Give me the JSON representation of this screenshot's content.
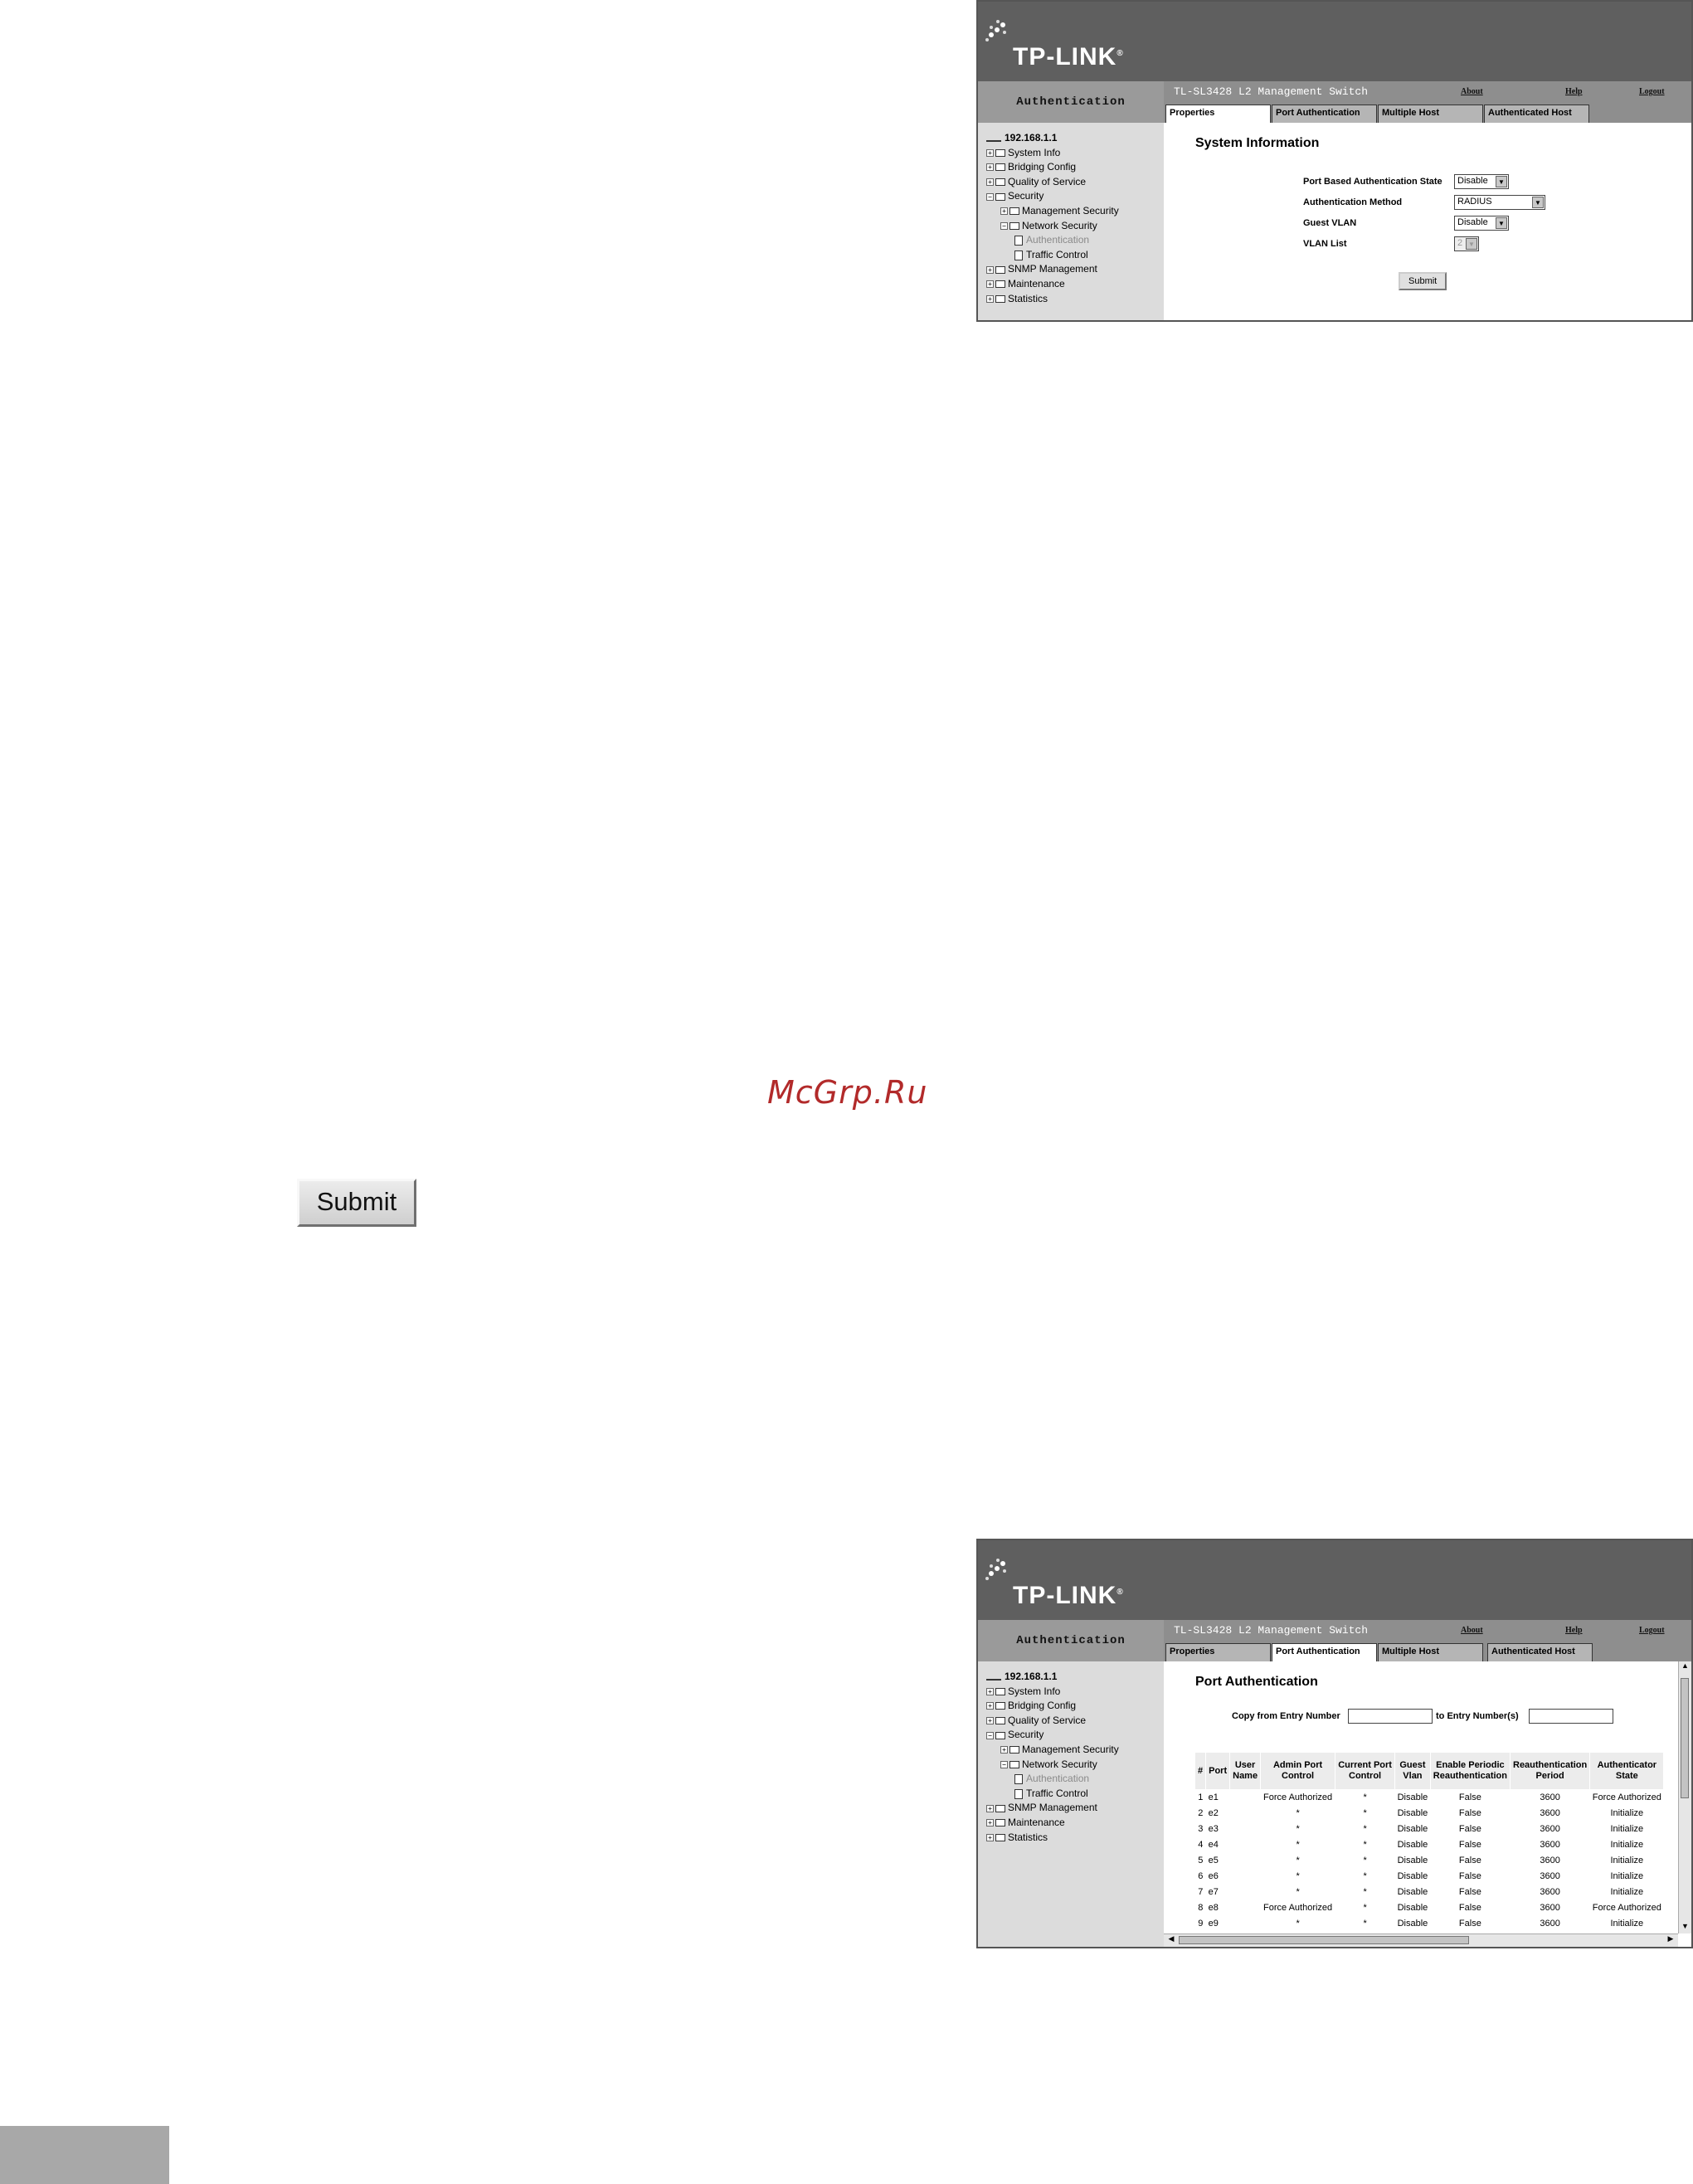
{
  "brand": {
    "logo_text": "TP-LINK",
    "trademark": "®"
  },
  "app": {
    "section": "Authentication",
    "title": "TL-SL3428 L2 Management Switch",
    "links": {
      "about": "About",
      "help": "Help",
      "logout": "Logout"
    },
    "tabs": [
      "Properties",
      "Port Authentication",
      "Multiple Host",
      "Authenticated Host"
    ]
  },
  "sidebar_tree": [
    {
      "label": "192.168.1.1",
      "level": 0,
      "type": "root"
    },
    {
      "label": "System Info",
      "level": 0,
      "type": "folder",
      "pm": "+"
    },
    {
      "label": "Bridging Config",
      "level": 0,
      "type": "folder",
      "pm": "+"
    },
    {
      "label": "Quality of Service",
      "level": 0,
      "type": "folder",
      "pm": "+"
    },
    {
      "label": "Security",
      "level": 0,
      "type": "folder",
      "pm": "−"
    },
    {
      "label": "Management Security",
      "level": 1,
      "type": "folder",
      "pm": "+"
    },
    {
      "label": "Network Security",
      "level": 1,
      "type": "folder",
      "pm": "−"
    },
    {
      "label": "Authentication",
      "level": 2,
      "type": "page",
      "dim": true
    },
    {
      "label": "Traffic Control",
      "level": 2,
      "type": "page"
    },
    {
      "label": "SNMP Management",
      "level": 0,
      "type": "folder",
      "pm": "+"
    },
    {
      "label": "Maintenance",
      "level": 0,
      "type": "folder",
      "pm": "+"
    },
    {
      "label": "Statistics",
      "level": 0,
      "type": "folder",
      "pm": "+"
    }
  ],
  "properties": {
    "heading": "System Information",
    "port_auth_state_label": "Port Based Authentication State",
    "port_auth_state_value": "Disable",
    "auth_method_label": "Authentication Method",
    "auth_method_value": "RADIUS",
    "guest_vlan_label": "Guest VLAN",
    "guest_vlan_value": "Disable",
    "vlan_list_label": "VLAN List",
    "vlan_list_value": "2",
    "submit_label": "Submit"
  },
  "port_auth": {
    "heading": "Port Authentication",
    "copy_from_label": "Copy from Entry Number",
    "to_entry_label": "to Entry Number(s)",
    "columns": [
      "#",
      "Port",
      "User Name",
      "Admin Port Control",
      "Current Port Control",
      "Guest Vlan",
      "Enable Periodic Reauthentication",
      "Reauthentication Period",
      "Authenticator State"
    ],
    "rows": [
      [
        "1",
        "e1",
        "",
        "Force Authorized",
        "*",
        "Disable",
        "False",
        "3600",
        "Force Authorized"
      ],
      [
        "2",
        "e2",
        "",
        "*",
        "*",
        "Disable",
        "False",
        "3600",
        "Initialize"
      ],
      [
        "3",
        "e3",
        "",
        "*",
        "*",
        "Disable",
        "False",
        "3600",
        "Initialize"
      ],
      [
        "4",
        "e4",
        "",
        "*",
        "*",
        "Disable",
        "False",
        "3600",
        "Initialize"
      ],
      [
        "5",
        "e5",
        "",
        "*",
        "*",
        "Disable",
        "False",
        "3600",
        "Initialize"
      ],
      [
        "6",
        "e6",
        "",
        "*",
        "*",
        "Disable",
        "False",
        "3600",
        "Initialize"
      ],
      [
        "7",
        "e7",
        "",
        "*",
        "*",
        "Disable",
        "False",
        "3600",
        "Initialize"
      ],
      [
        "8",
        "e8",
        "",
        "Force Authorized",
        "*",
        "Disable",
        "False",
        "3600",
        "Force Authorized"
      ],
      [
        "9",
        "e9",
        "",
        "*",
        "*",
        "Disable",
        "False",
        "3600",
        "Initialize"
      ]
    ]
  },
  "watermark": "McGrp.Ru",
  "standalone_submit": "Submit"
}
